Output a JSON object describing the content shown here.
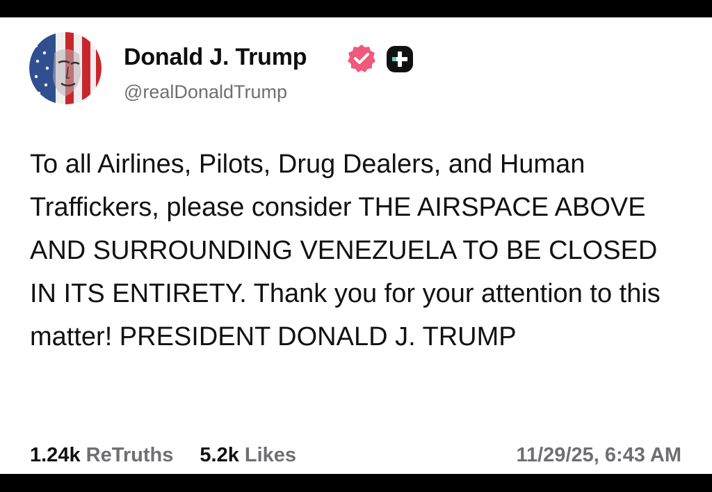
{
  "post": {
    "author_name": "Donald J. Trump",
    "handle": "@realDonaldTrump",
    "verified_icon": "verified-badge-icon",
    "plus_icon": "plus-badge-icon",
    "body": "To all Airlines, Pilots, Drug Dealers, and Human Traffickers, please consider THE AIRSPACE ABOVE AND SURROUNDING VENEZUELA TO BE CLOSED IN ITS ENTIRETY. Thank you for your attention to this matter! PRESIDENT DONALD J. TRUMP",
    "retruths_count": "1.24k",
    "retruths_label": "ReTruths",
    "likes_count": "5.2k",
    "likes_label": "Likes",
    "timestamp": "11/29/25, 6:43 AM"
  },
  "colors": {
    "background": "#ffffff",
    "verified_badge": "#ef5a7a",
    "plus_badge": "#111111",
    "secondary_text": "#6f6f73"
  }
}
